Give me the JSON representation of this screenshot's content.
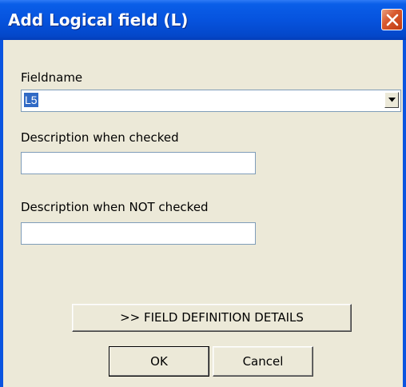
{
  "window": {
    "title": "Add Logical field (L)",
    "close_icon": "close-icon",
    "accent_color": "#0a54e0",
    "close_color": "#d85a30"
  },
  "form": {
    "fieldname_label": "Fieldname",
    "fieldname_value": "L5",
    "desc_checked_label": "Description when checked",
    "desc_checked_value": "",
    "desc_not_checked_label": "Description when NOT checked",
    "desc_not_checked_value": ""
  },
  "buttons": {
    "details_label": ">> FIELD DEFINITION DETAILS",
    "ok_label": "OK",
    "cancel_label": "Cancel"
  },
  "icons": {
    "dropdown": "chevron-down-icon"
  }
}
